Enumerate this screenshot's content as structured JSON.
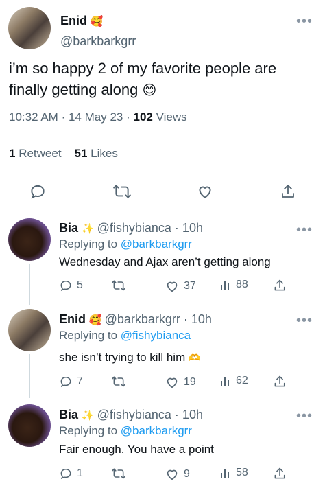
{
  "main_tweet": {
    "name": "Enid",
    "name_emoji": "🥰",
    "handle": "@barkbarkgrr",
    "more": "•••",
    "text_line1": "i’m so happy 2 of my favorite people are",
    "text_line2": "finally getting along",
    "text_emoji": "😊",
    "time": "10:32 AM",
    "sep1": "·",
    "date": "14 May 23",
    "sep2": "·",
    "views_count": "102",
    "views_label": "Views",
    "retweets_count": "1",
    "retweets_label": "Retweet",
    "likes_count": "51",
    "likes_label": "Likes"
  },
  "replies": [
    {
      "name": "Bia",
      "name_emoji": "✨",
      "handle_time": "@fishybianca · 10h",
      "replying_prefix": "Replying to",
      "replying_handle": "@barkbarkgrr",
      "text": "Wednesday and Ajax aren’t getting along",
      "text_emoji": "",
      "replies": "5",
      "retweets": "",
      "likes": "37",
      "views": "88"
    },
    {
      "name": "Enid",
      "name_emoji": "🥰",
      "handle_time": "@barkbarkgrr · 10h",
      "replying_prefix": "Replying to",
      "replying_handle": "@fishybianca",
      "text": "she isn’t trying to kill him",
      "text_emoji": "🫶",
      "replies": "7",
      "retweets": "",
      "likes": "19",
      "views": "62"
    },
    {
      "name": "Bia",
      "name_emoji": "✨",
      "handle_time": "@fishybianca · 10h",
      "replying_prefix": "Replying to",
      "replying_handle": "@barkbarkgrr",
      "text": "Fair enough. You have a point",
      "text_emoji": "",
      "replies": "1",
      "retweets": "",
      "likes": "9",
      "views": "58"
    }
  ],
  "more": "•••",
  "colors": {
    "link": "#1d9bf0",
    "muted": "#536471",
    "text": "#0f1419"
  }
}
